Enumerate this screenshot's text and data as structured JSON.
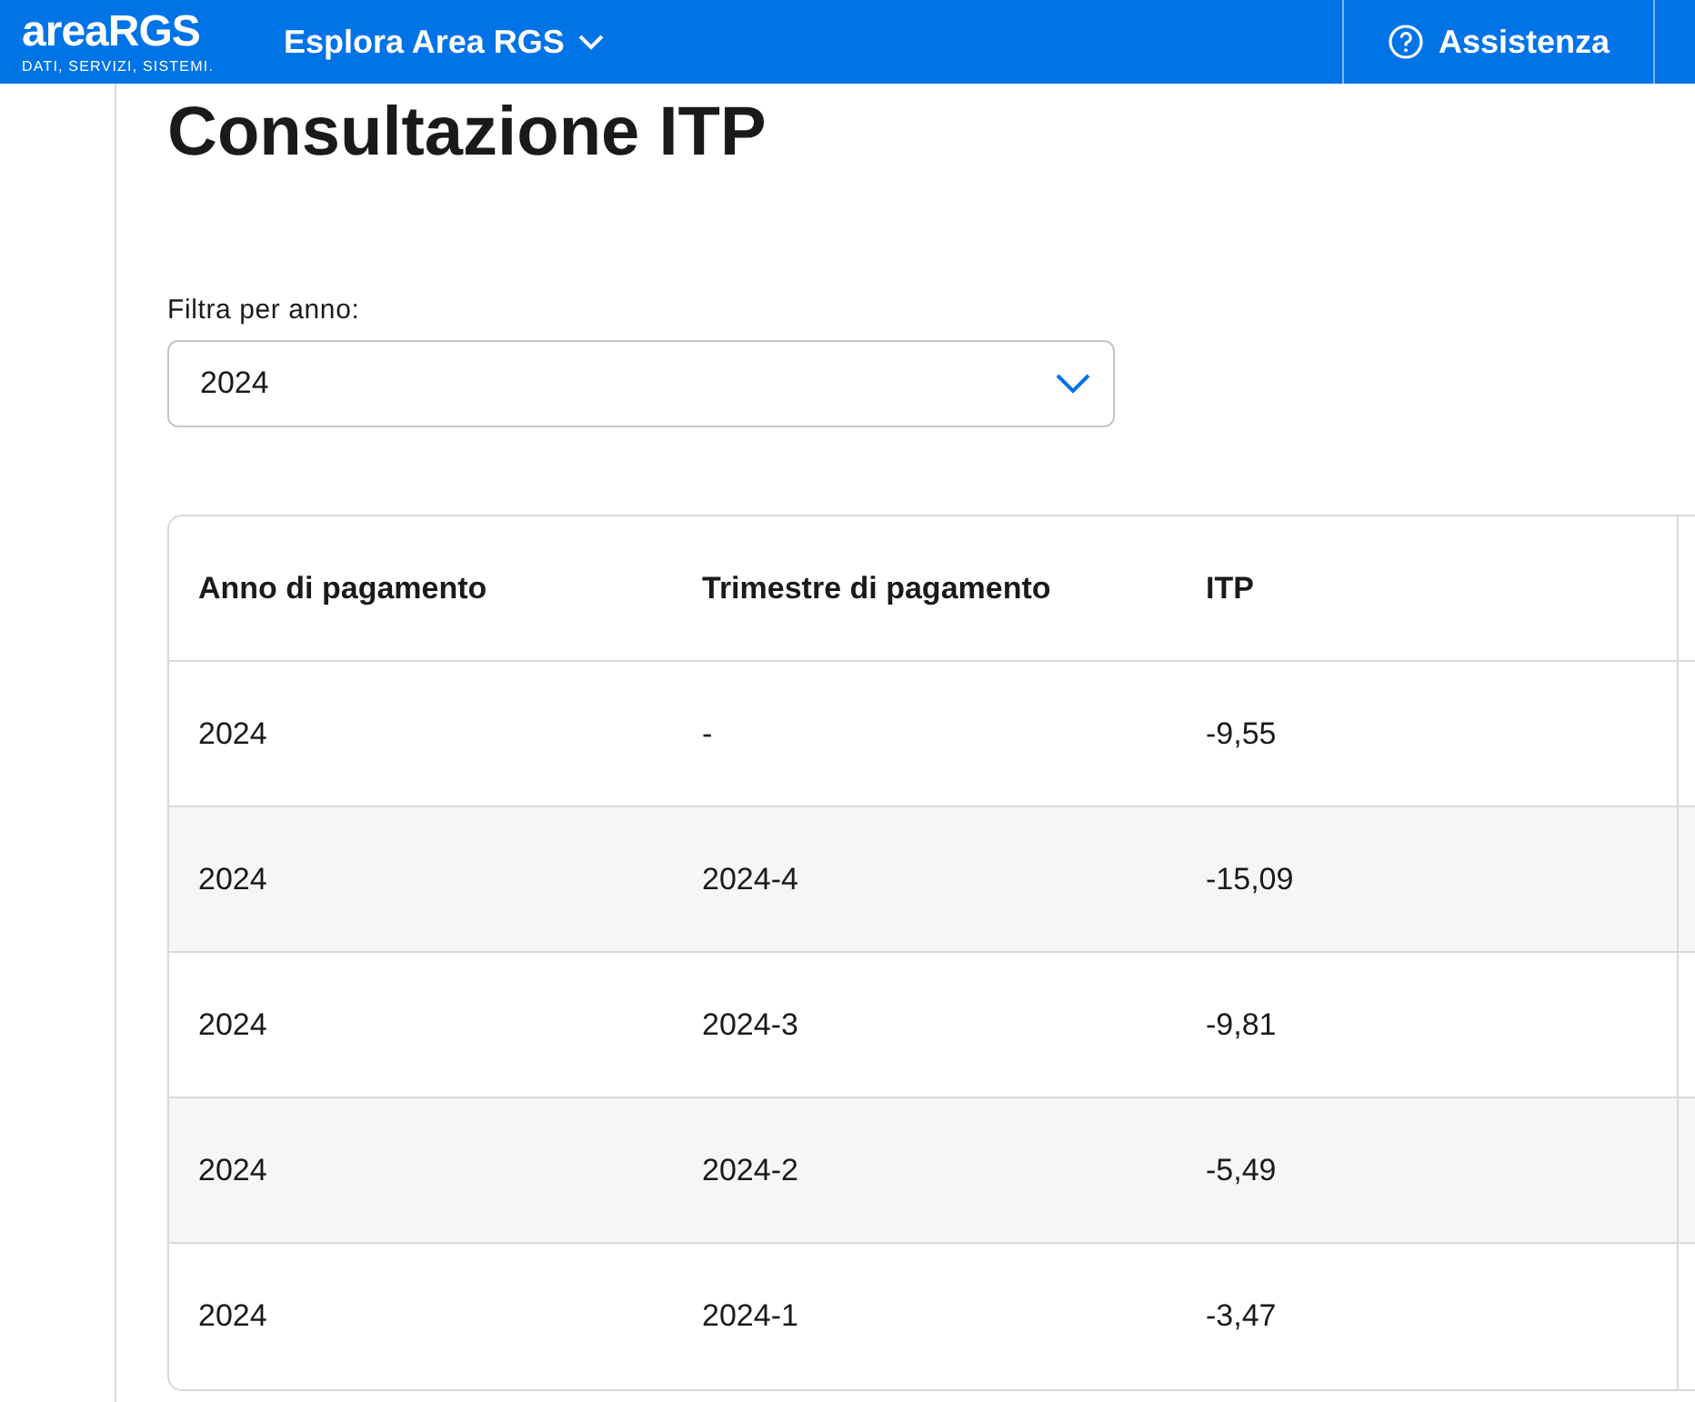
{
  "header": {
    "logo": "areaRGS",
    "logo_tagline": "DATI, SERVIZI, SISTEMI.",
    "nav": "Esplora Area RGS",
    "help": "Assistenza"
  },
  "title": "Consultazione ITP",
  "filter": {
    "label": "Filtra per anno:",
    "value": "2024"
  },
  "table": {
    "columns": [
      "Anno di pagamento",
      "Trimestre di pagamento",
      "ITP"
    ],
    "rows": [
      [
        "2024",
        "-",
        "-9,55"
      ],
      [
        "2024",
        "2024-4",
        "-15,09"
      ],
      [
        "2024",
        "2024-3",
        "-9,81"
      ],
      [
        "2024",
        "2024-2",
        "-5,49"
      ],
      [
        "2024",
        "2024-1",
        "-3,47"
      ]
    ]
  }
}
